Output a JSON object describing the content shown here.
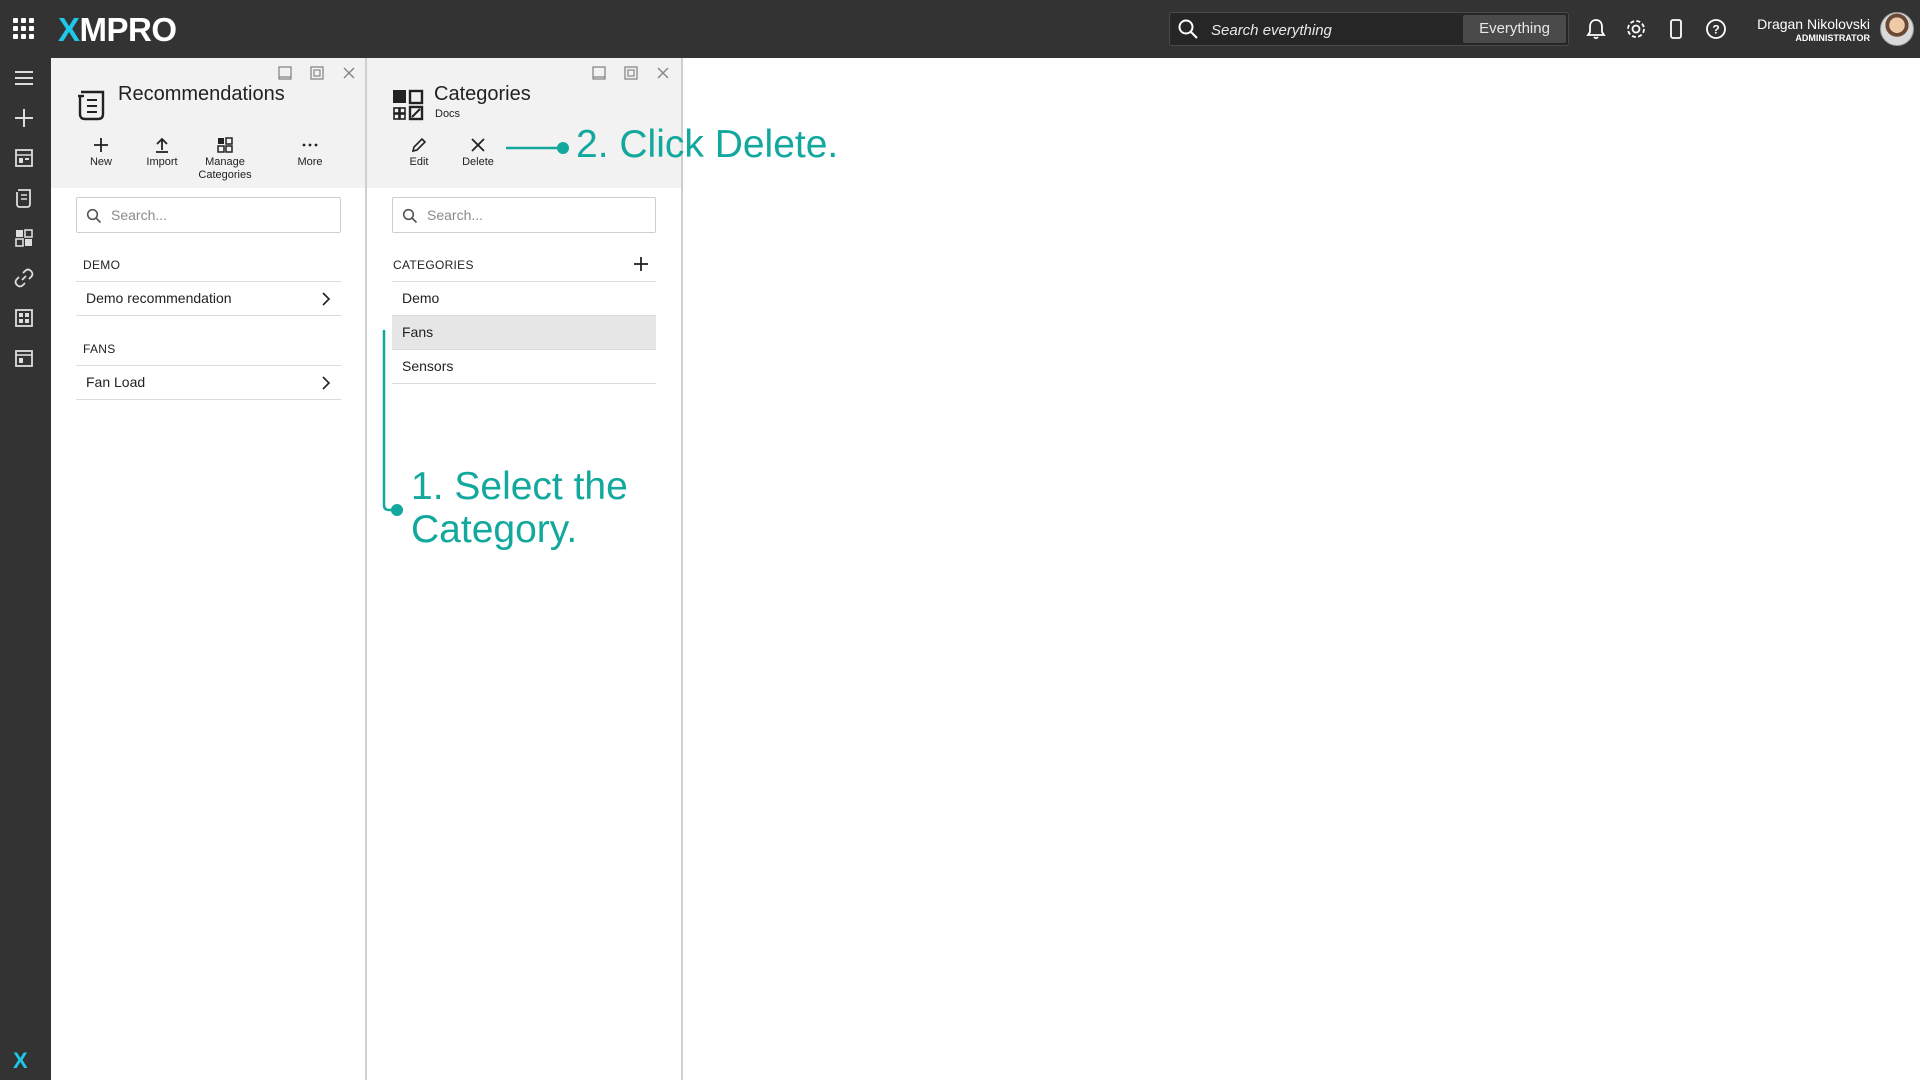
{
  "app": {
    "logo_prefix": "X",
    "logo_suffix": "MPRO"
  },
  "topbar": {
    "search_placeholder": "Search everything",
    "search_scope": "Everything",
    "user_name": "Dragan Nikolovski",
    "user_role": "ADMINISTRATOR",
    "icons": [
      "bell-icon",
      "gear-icon",
      "mobile-icon",
      "help-icon"
    ]
  },
  "leftnav": {
    "icons": [
      "menu-icon",
      "add-icon",
      "dashboard-icon",
      "recommendations-icon",
      "apps-icon",
      "link-icon",
      "data-stream-icon",
      "calendar-icon"
    ]
  },
  "recommendations_panel": {
    "title": "Recommendations",
    "toolbar": {
      "new": "New",
      "import": "Import",
      "manage_1": "Manage",
      "manage_2": "Categories",
      "more": "More"
    },
    "search_placeholder": "Search...",
    "groups": [
      {
        "header": "DEMO",
        "items": [
          "Demo recommendation"
        ]
      },
      {
        "header": "FANS",
        "items": [
          "Fan Load"
        ]
      }
    ]
  },
  "categories_panel": {
    "title": "Categories",
    "subtitle": "Docs",
    "toolbar": {
      "edit": "Edit",
      "delete": "Delete"
    },
    "search_placeholder": "Search...",
    "list_header": "CATEGORIES",
    "items": [
      "Demo",
      "Fans",
      "Sensors"
    ],
    "selected_item": "Fans"
  },
  "annotations": {
    "step1_line1": "1. Select the",
    "step1_line2": "Category.",
    "step2": "2. Click Delete."
  },
  "colors": {
    "accent": "#12a89d",
    "topbar": "#333333",
    "logo_x": "#1ec8e8",
    "selected_row": "#e6e6e6"
  }
}
